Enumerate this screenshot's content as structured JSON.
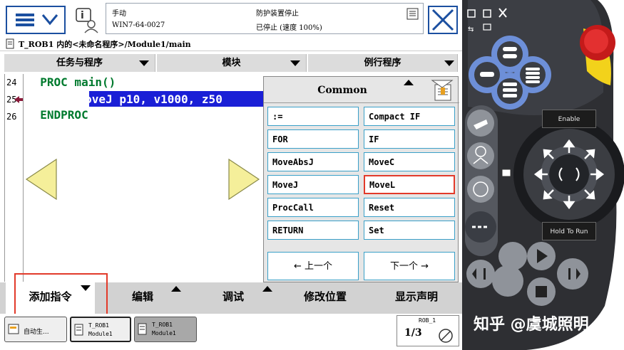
{
  "header": {
    "mode": "手动",
    "controller": "WIN7-64-0027",
    "safety": "防护装置停止",
    "state": "已停止 (速度 100%)"
  },
  "path_bar": {
    "text": "T_ROB1 内的<未命名程序>/Module1/main"
  },
  "tabs": [
    {
      "label": "任务与程序"
    },
    {
      "label": "模块"
    },
    {
      "label": "例行程序"
    }
  ],
  "editor": {
    "lines": [
      {
        "num": "24",
        "code": "  PROC main()"
      },
      {
        "num": "25",
        "code": "    MoveJ p10, v1000, z50"
      },
      {
        "num": "26",
        "code": "  ENDPROC"
      }
    ]
  },
  "popup": {
    "title": "Common",
    "commands": [
      ":=",
      "Compact IF",
      "FOR",
      "IF",
      "MoveAbsJ",
      "MoveC",
      "MoveJ",
      "MoveL",
      "ProcCall",
      "Reset",
      "RETURN",
      "Set"
    ],
    "prev_label": "←  上一个",
    "next_label": "下一个  →"
  },
  "bottom_bar": {
    "add_instruction": "添加指令",
    "edit": "编辑",
    "debug": "调试",
    "modify_position": "修改位置",
    "show_declaration": "显示声明"
  },
  "taskbar": {
    "auto_label": "自动生...",
    "task1_line1": "T_ROB1",
    "task1_line2": "Module1",
    "task2_line1": "T_ROB1",
    "task2_line2": "Module1",
    "robot_label": "ROB_1",
    "fraction": "1/3"
  },
  "pendant": {
    "enable_label": "Enable",
    "hold_label": "Hold To Run"
  },
  "watermark": "知乎 @虞城照明",
  "colors": {
    "accent_blue": "#1b4fa0",
    "selection_blue": "#1a1fd6",
    "code_green": "#007a2e",
    "highlight_red": "#e23a2a",
    "command_border": "#3aa0c8",
    "pendant_body": "#2e2f33",
    "emergency_red": "#d81e1e",
    "pendant_yellow": "#f2d21b"
  },
  "icons": [
    "menu-icon",
    "chevron-down-icon",
    "info-user-icon",
    "close-icon",
    "scroll-left-icon",
    "scroll-right-icon"
  ]
}
